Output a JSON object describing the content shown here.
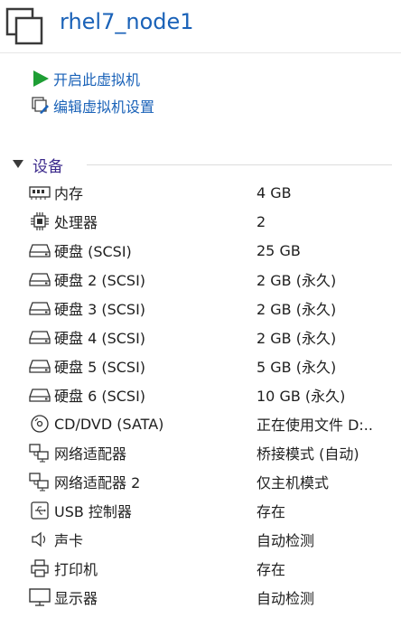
{
  "header": {
    "title": "rhel7_node1"
  },
  "actions": [
    {
      "label": "开启此虚拟机",
      "icon": "play-icon"
    },
    {
      "label": "编辑虚拟机设置",
      "icon": "edit-settings-icon"
    }
  ],
  "devices_section": {
    "title": "设备"
  },
  "devices": [
    {
      "name": "内存",
      "value": "4 GB",
      "icon": "memory-icon"
    },
    {
      "name": "处理器",
      "value": "2",
      "icon": "cpu-icon"
    },
    {
      "name": "硬盘 (SCSI)",
      "value": "25 GB",
      "icon": "hard-disk-icon"
    },
    {
      "name": "硬盘 2 (SCSI)",
      "value": "2 GB (永久)",
      "icon": "hard-disk-icon"
    },
    {
      "name": "硬盘 3 (SCSI)",
      "value": "2 GB (永久)",
      "icon": "hard-disk-icon"
    },
    {
      "name": "硬盘 4 (SCSI)",
      "value": "2 GB (永久)",
      "icon": "hard-disk-icon"
    },
    {
      "name": "硬盘 5 (SCSI)",
      "value": "5 GB (永久)",
      "icon": "hard-disk-icon"
    },
    {
      "name": "硬盘 6 (SCSI)",
      "value": "10 GB (永久)",
      "icon": "hard-disk-icon"
    },
    {
      "name": "CD/DVD (SATA)",
      "value": "正在使用文件 D:..",
      "icon": "cd-dvd-icon"
    },
    {
      "name": "网络适配器",
      "value": "桥接模式 (自动)",
      "icon": "network-adapter-icon"
    },
    {
      "name": "网络适配器 2",
      "value": "仅主机模式",
      "icon": "network-adapter-icon"
    },
    {
      "name": "USB 控制器",
      "value": "存在",
      "icon": "usb-icon"
    },
    {
      "name": "声卡",
      "value": "自动检测",
      "icon": "speaker-icon"
    },
    {
      "name": "打印机",
      "value": "存在",
      "icon": "printer-icon"
    },
    {
      "name": "显示器",
      "value": "自动检测",
      "icon": "monitor-icon"
    }
  ]
}
